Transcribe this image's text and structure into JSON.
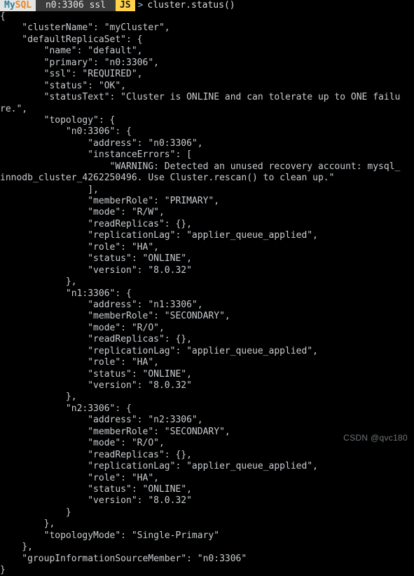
{
  "terminal": {
    "background": "#000000",
    "foreground": "#c9cdd1",
    "prompt": {
      "brand_my": "My",
      "brand_sql": "SQL",
      "brand_bg": "#e3e5e2",
      "host": " n0:3306 ssl ",
      "host_bg": "#3b3b3b",
      "mode": "JS",
      "mode_bg": "#ffd24a",
      "caret": ">",
      "command": "cluster.status()"
    },
    "output_lines": [
      "{",
      "    \"clusterName\": \"myCluster\",",
      "    \"defaultReplicaSet\": {",
      "        \"name\": \"default\",",
      "        \"primary\": \"n0:3306\",",
      "        \"ssl\": \"REQUIRED\",",
      "        \"status\": \"OK\",",
      "        \"statusText\": \"Cluster is ONLINE and can tolerate up to ONE failu",
      "re.\",",
      "        \"topology\": {",
      "            \"n0:3306\": {",
      "                \"address\": \"n0:3306\",",
      "                \"instanceErrors\": [",
      "                    \"WARNING: Detected an unused recovery account: mysql_",
      "innodb_cluster_4262250496. Use Cluster.rescan() to clean up.\"",
      "                ],",
      "                \"memberRole\": \"PRIMARY\",",
      "                \"mode\": \"R/W\",",
      "                \"readReplicas\": {},",
      "                \"replicationLag\": \"applier_queue_applied\",",
      "                \"role\": \"HA\",",
      "                \"status\": \"ONLINE\",",
      "                \"version\": \"8.0.32\"",
      "            },",
      "            \"n1:3306\": {",
      "                \"address\": \"n1:3306\",",
      "                \"memberRole\": \"SECONDARY\",",
      "                \"mode\": \"R/O\",",
      "                \"readReplicas\": {},",
      "                \"replicationLag\": \"applier_queue_applied\",",
      "                \"role\": \"HA\",",
      "                \"status\": \"ONLINE\",",
      "                \"version\": \"8.0.32\"",
      "            },",
      "            \"n2:3306\": {",
      "                \"address\": \"n2:3306\",",
      "                \"memberRole\": \"SECONDARY\",",
      "                \"mode\": \"R/O\",",
      "                \"readReplicas\": {},",
      "                \"replicationLag\": \"applier_queue_applied\",",
      "                \"role\": \"HA\",",
      "                \"status\": \"ONLINE\",",
      "                \"version\": \"8.0.32\"",
      "            }",
      "        },",
      "        \"topologyMode\": \"Single-Primary\"",
      "    },",
      "    \"groupInformationSourceMember\": \"n0:3306\"",
      "}"
    ]
  },
  "watermark": {
    "text": "CSDN @qvc180"
  }
}
